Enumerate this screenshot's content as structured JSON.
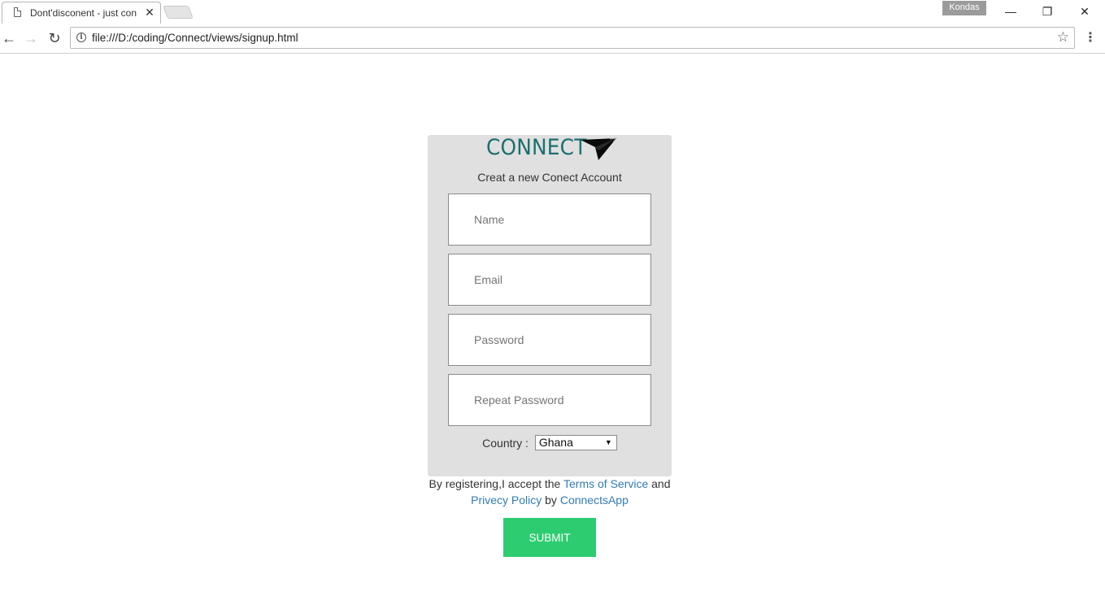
{
  "browser": {
    "tab_title": "Dont'disconent - just con",
    "tab_close": "✕",
    "profile_name": "Kondas",
    "window_controls": {
      "minimize": "—",
      "restore": "❐",
      "close": "✕"
    },
    "url": "file:///D:/coding/Connect/views/signup.html",
    "nav": {
      "back": "←",
      "forward": "→",
      "reload": "↻"
    },
    "star_glyph": "☆",
    "menu_glyph": "⋮"
  },
  "page": {
    "logo_text": "CONNECT",
    "logo_icon": "paper-plane-icon",
    "subtitle": "Creat a new Conect Account",
    "fields": {
      "name_placeholder": "Name",
      "email_placeholder": "Email",
      "password_placeholder": "Password",
      "repeat_password_placeholder": "Repeat Password"
    },
    "country": {
      "label": "Country :",
      "selected": "Ghana",
      "caret": "▼"
    },
    "terms": {
      "prefix": "By registering,I accept the",
      "terms_link": "Terms of Service",
      "and": "and",
      "privacy_link": "Privecy Policy",
      "by": "by",
      "app_link": "ConnectsApp"
    },
    "submit_label": "SUBMIT"
  },
  "colors": {
    "logo": "#1b6f6e",
    "card_bg": "#e0e0e0",
    "link": "#337ab7",
    "submit_bg": "#2ecc71"
  }
}
